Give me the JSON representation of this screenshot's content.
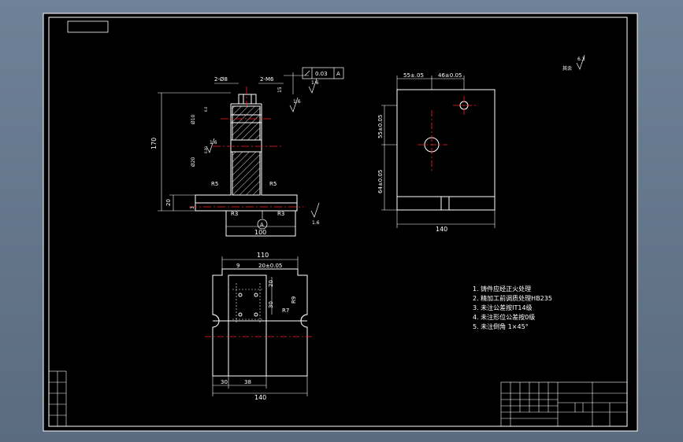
{
  "colors": {
    "background": "#000000",
    "line": "#ffffff",
    "centerline": "#ff2020",
    "hatch": "#ffffff",
    "border": "#ffffff"
  },
  "front_view": {
    "dim_overall_height": "170",
    "dim_base_height": "20",
    "dim_base_width": "100",
    "dim_side_small": "3",
    "slot_label_1": "2-Ø8",
    "slot_label_2": "2-M6",
    "hole_dim_upper": "Ø10",
    "hole_dim_lower": "Ø20",
    "tol_small_1": "6.0",
    "tol_small_2": "0.00",
    "dim_top_side": "15",
    "roughness_1": "1.6",
    "roughness_2": "1.6",
    "roughness_3": "1.6",
    "roughness_4": "1.6",
    "radius_r5_left": "R5",
    "radius_r5_right": "R5",
    "radius_r3_left": "R3",
    "radius_r3_right": "R3",
    "datum": "A",
    "gdt_value": "0.03",
    "gdt_datum": "A"
  },
  "side_view": {
    "dim_top_left": "55±.05",
    "dim_top_right": "46±0.05",
    "dim_left_upper": "55±0.05",
    "dim_left_lower": "64±0.05",
    "dim_bottom": "140"
  },
  "top_view": {
    "dim_top": "110",
    "dim_9": "9",
    "dim_20": "20±0.05",
    "dim_inner_vertical_1": "20",
    "dim_inner_vertical_2": "30",
    "radius_r9": "R9",
    "radius_r7": "R7",
    "dim_30": "30",
    "dim_38": "38",
    "dim_bottom": "140"
  },
  "roughness_other": {
    "value": "6.3",
    "label": "其余"
  },
  "notes": [
    "1. 铸件应经正火处理",
    "2. 精加工前调质处理HB235",
    "3. 未注公差按IT14级",
    "4. 未注形位公差按0级",
    "5. 未注倒角 1×45°"
  ]
}
